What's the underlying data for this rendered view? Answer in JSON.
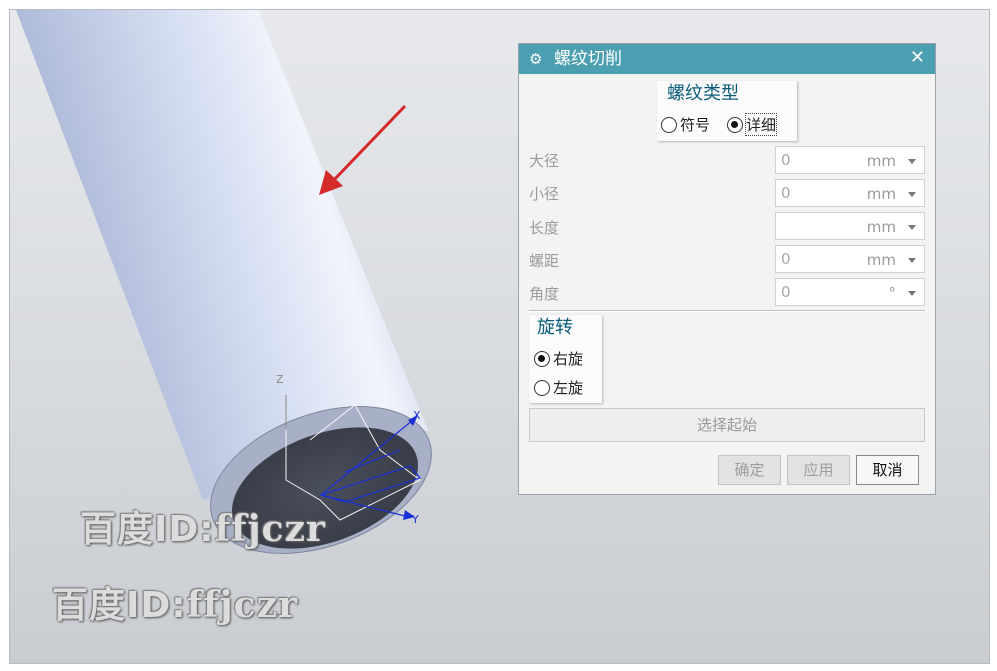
{
  "dialog": {
    "title": "螺纹切削",
    "close_glyph": "✕",
    "gear_glyph": "⚙",
    "thread_type": {
      "title": "螺纹类型",
      "options": [
        {
          "label": "符号",
          "selected": false
        },
        {
          "label": "详细",
          "selected": true
        }
      ]
    },
    "fields": [
      {
        "label": "大径",
        "value": "0",
        "unit": "mm"
      },
      {
        "label": "小径",
        "value": "0",
        "unit": "mm"
      },
      {
        "label": "长度",
        "value": "",
        "unit": "mm"
      },
      {
        "label": "螺距",
        "value": "0",
        "unit": "mm"
      },
      {
        "label": "角度",
        "value": "0",
        "unit": "°"
      }
    ],
    "rotation": {
      "title": "旋转",
      "options": [
        {
          "label": "右旋",
          "selected": true
        },
        {
          "label": "左旋",
          "selected": false
        }
      ]
    },
    "select_start_label": "选择起始",
    "buttons": {
      "ok": "确定",
      "apply": "应用",
      "cancel": "取消"
    }
  },
  "scene": {
    "axis_labels": {
      "x": "X",
      "y": "Y",
      "z": "Z"
    },
    "arrow_color": "#d42a2a",
    "cylinder_color": "#c9d3ec",
    "csys_color": "#1a2fd6"
  },
  "watermark": {
    "cjk": "百度ID:",
    "id": "ffjczr"
  }
}
